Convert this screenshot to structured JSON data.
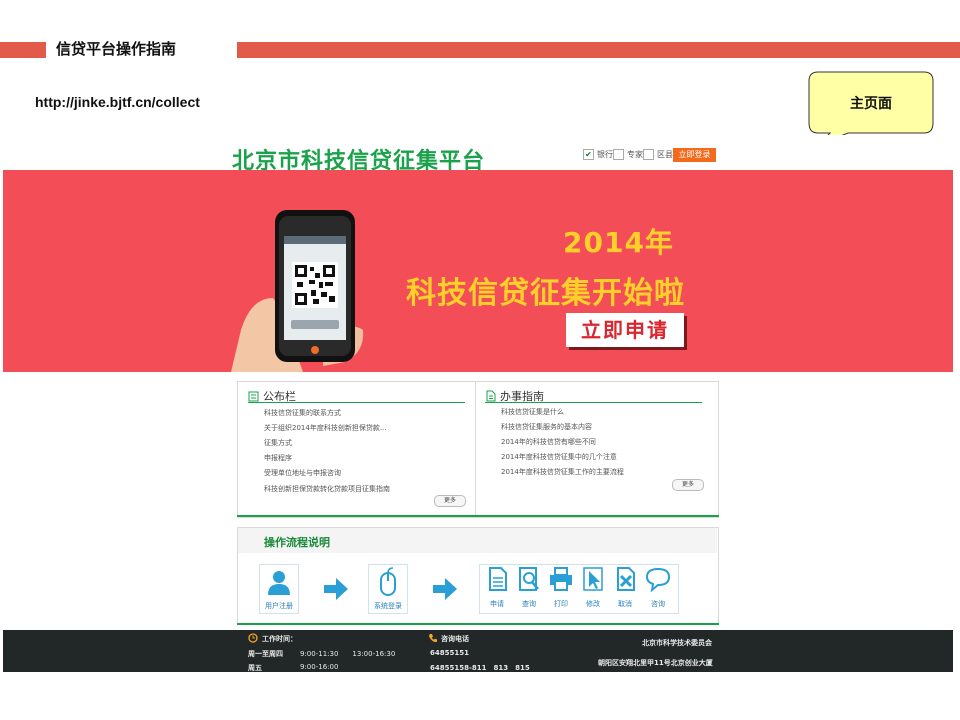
{
  "slide": {
    "title": "信贷平台操作指南",
    "url": "http://jinke.bjtf.cn/collect",
    "callout": "主页面"
  },
  "site": {
    "logo": "北京市科技信贷征集平台",
    "roles": [
      {
        "label": "银行",
        "checked": true
      },
      {
        "label": "专家",
        "checked": false
      },
      {
        "label": "区县",
        "checked": false
      }
    ],
    "login_label": "立即登录"
  },
  "banner": {
    "year": "2014年",
    "slogan": "科技信贷征集开始啦",
    "apply_label": "立即申请"
  },
  "bulletin": {
    "title": "公布栏",
    "items": [
      "科技信贷征集的联系方式",
      "关于组织2014年度科技创新担保贷款...",
      "征集方式",
      "申报程序",
      "受理单位地址与申报咨询",
      "科技创新担保贷款转化贷款项目征集指南"
    ],
    "more_label": "更多"
  },
  "guide": {
    "title": "办事指南",
    "items": [
      "科技信贷征集是什么",
      "科技信贷征集服务的基本内容",
      "2014年的科技信贷有哪些不同",
      "2014年度科技信贷征集中的几个注意",
      "2014年度科技信贷征集工作的主要流程"
    ],
    "more_label": "更多"
  },
  "process": {
    "title": "操作流程说明",
    "register_label": "用户注册",
    "login_label": "系统登录",
    "actions": [
      {
        "label": "申请",
        "icon": "document-icon"
      },
      {
        "label": "查询",
        "icon": "search-icon"
      },
      {
        "label": "打印",
        "icon": "printer-icon"
      },
      {
        "label": "修改",
        "icon": "cursor-icon"
      },
      {
        "label": "取消",
        "icon": "cancel-icon"
      },
      {
        "label": "咨询",
        "icon": "chat-icon"
      }
    ]
  },
  "footer": {
    "hours_title": "工作时间：",
    "hours_row1_days": "周一至周四",
    "hours_row1_times": "9:00-11:30　　13:00-16:30",
    "hours_row2_days": "周五",
    "hours_row2_times": "9:00-16:00",
    "phone_title": "咨询电话",
    "phone_1": "64855151",
    "phone_2": "64855158-811　813　815",
    "org": "北京市科学技术委员会",
    "address": "朝阳区安翔北里甲11号北京创业大厦"
  },
  "colors": {
    "accent_red": "#e25a4a",
    "banner_red": "#f34e57",
    "brand_green": "#1aa24a",
    "login_orange": "#f46a1c",
    "slogan_yellow": "#ffd02a",
    "step_blue": "#2a9fd6",
    "footer_dark": "#222728"
  }
}
